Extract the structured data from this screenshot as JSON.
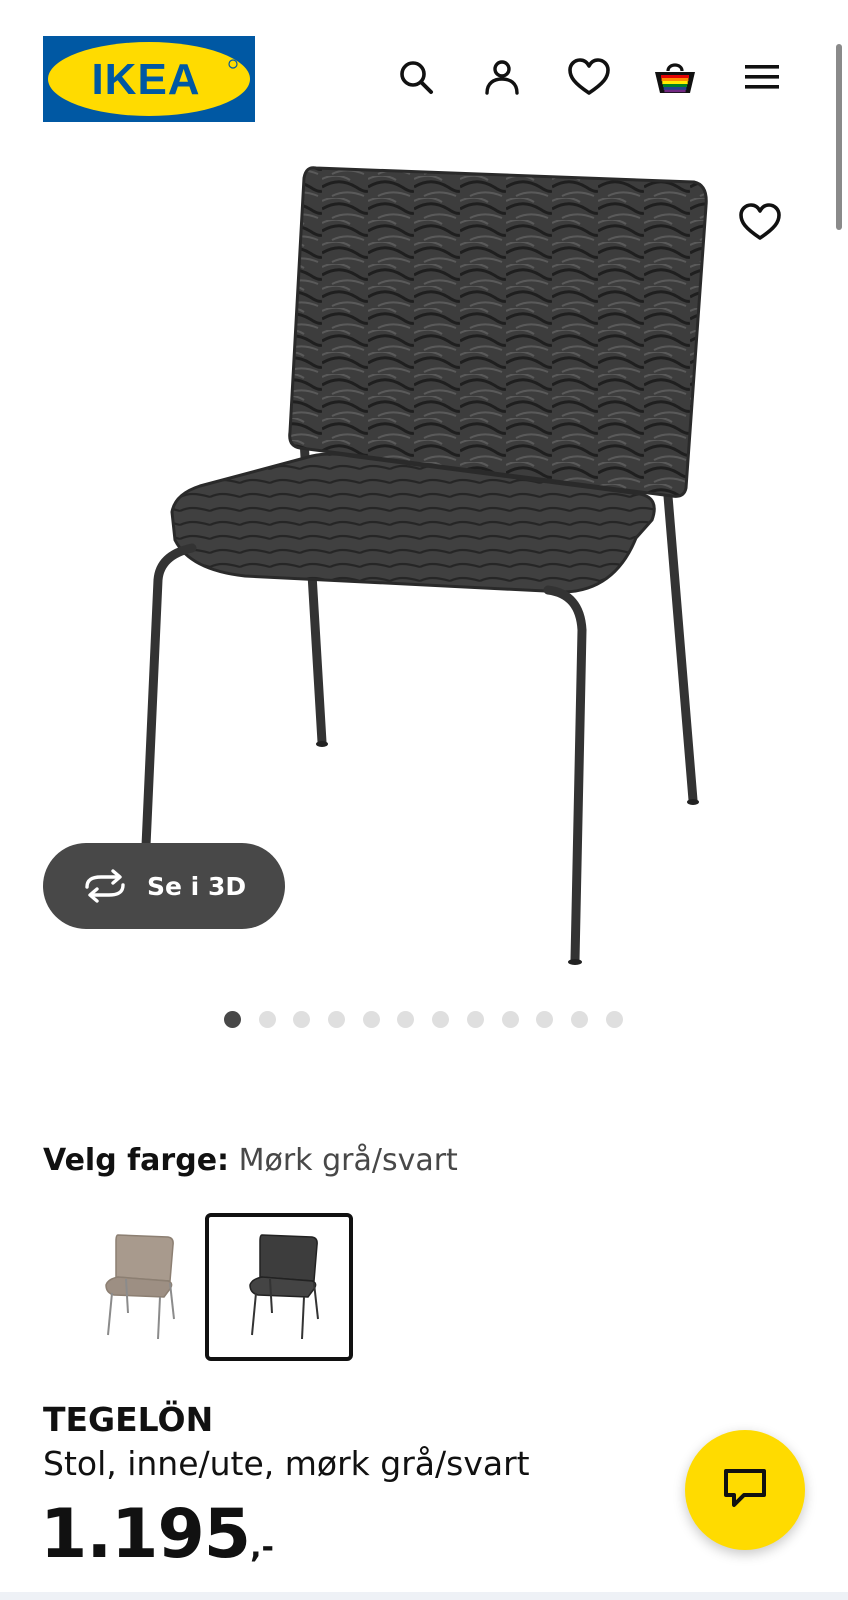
{
  "header": {
    "logo_text": "IKEA",
    "logo_colors": {
      "blue": "#0058a3",
      "yellow": "#ffdb00"
    },
    "icons": [
      "search-icon",
      "user-icon",
      "heart-icon",
      "basket-icon",
      "menu-icon"
    ]
  },
  "gallery": {
    "view_3d_label": "Se i 3D",
    "image_count": 12,
    "active_index": 0
  },
  "color_selector": {
    "label": "Velg farge:",
    "value": "Mørk grå/svart",
    "options": [
      "Beige",
      "Mørk grå/svart"
    ],
    "selected_index": 1
  },
  "product": {
    "name": "TEGELÖN",
    "description": "Stol, inne/ute, mørk grå/svart",
    "price_integer": "1.195",
    "price_decimal": ",-"
  },
  "colors": {
    "accent_yellow": "#ffdb00",
    "dark_button": "#484848",
    "text": "#111111"
  }
}
